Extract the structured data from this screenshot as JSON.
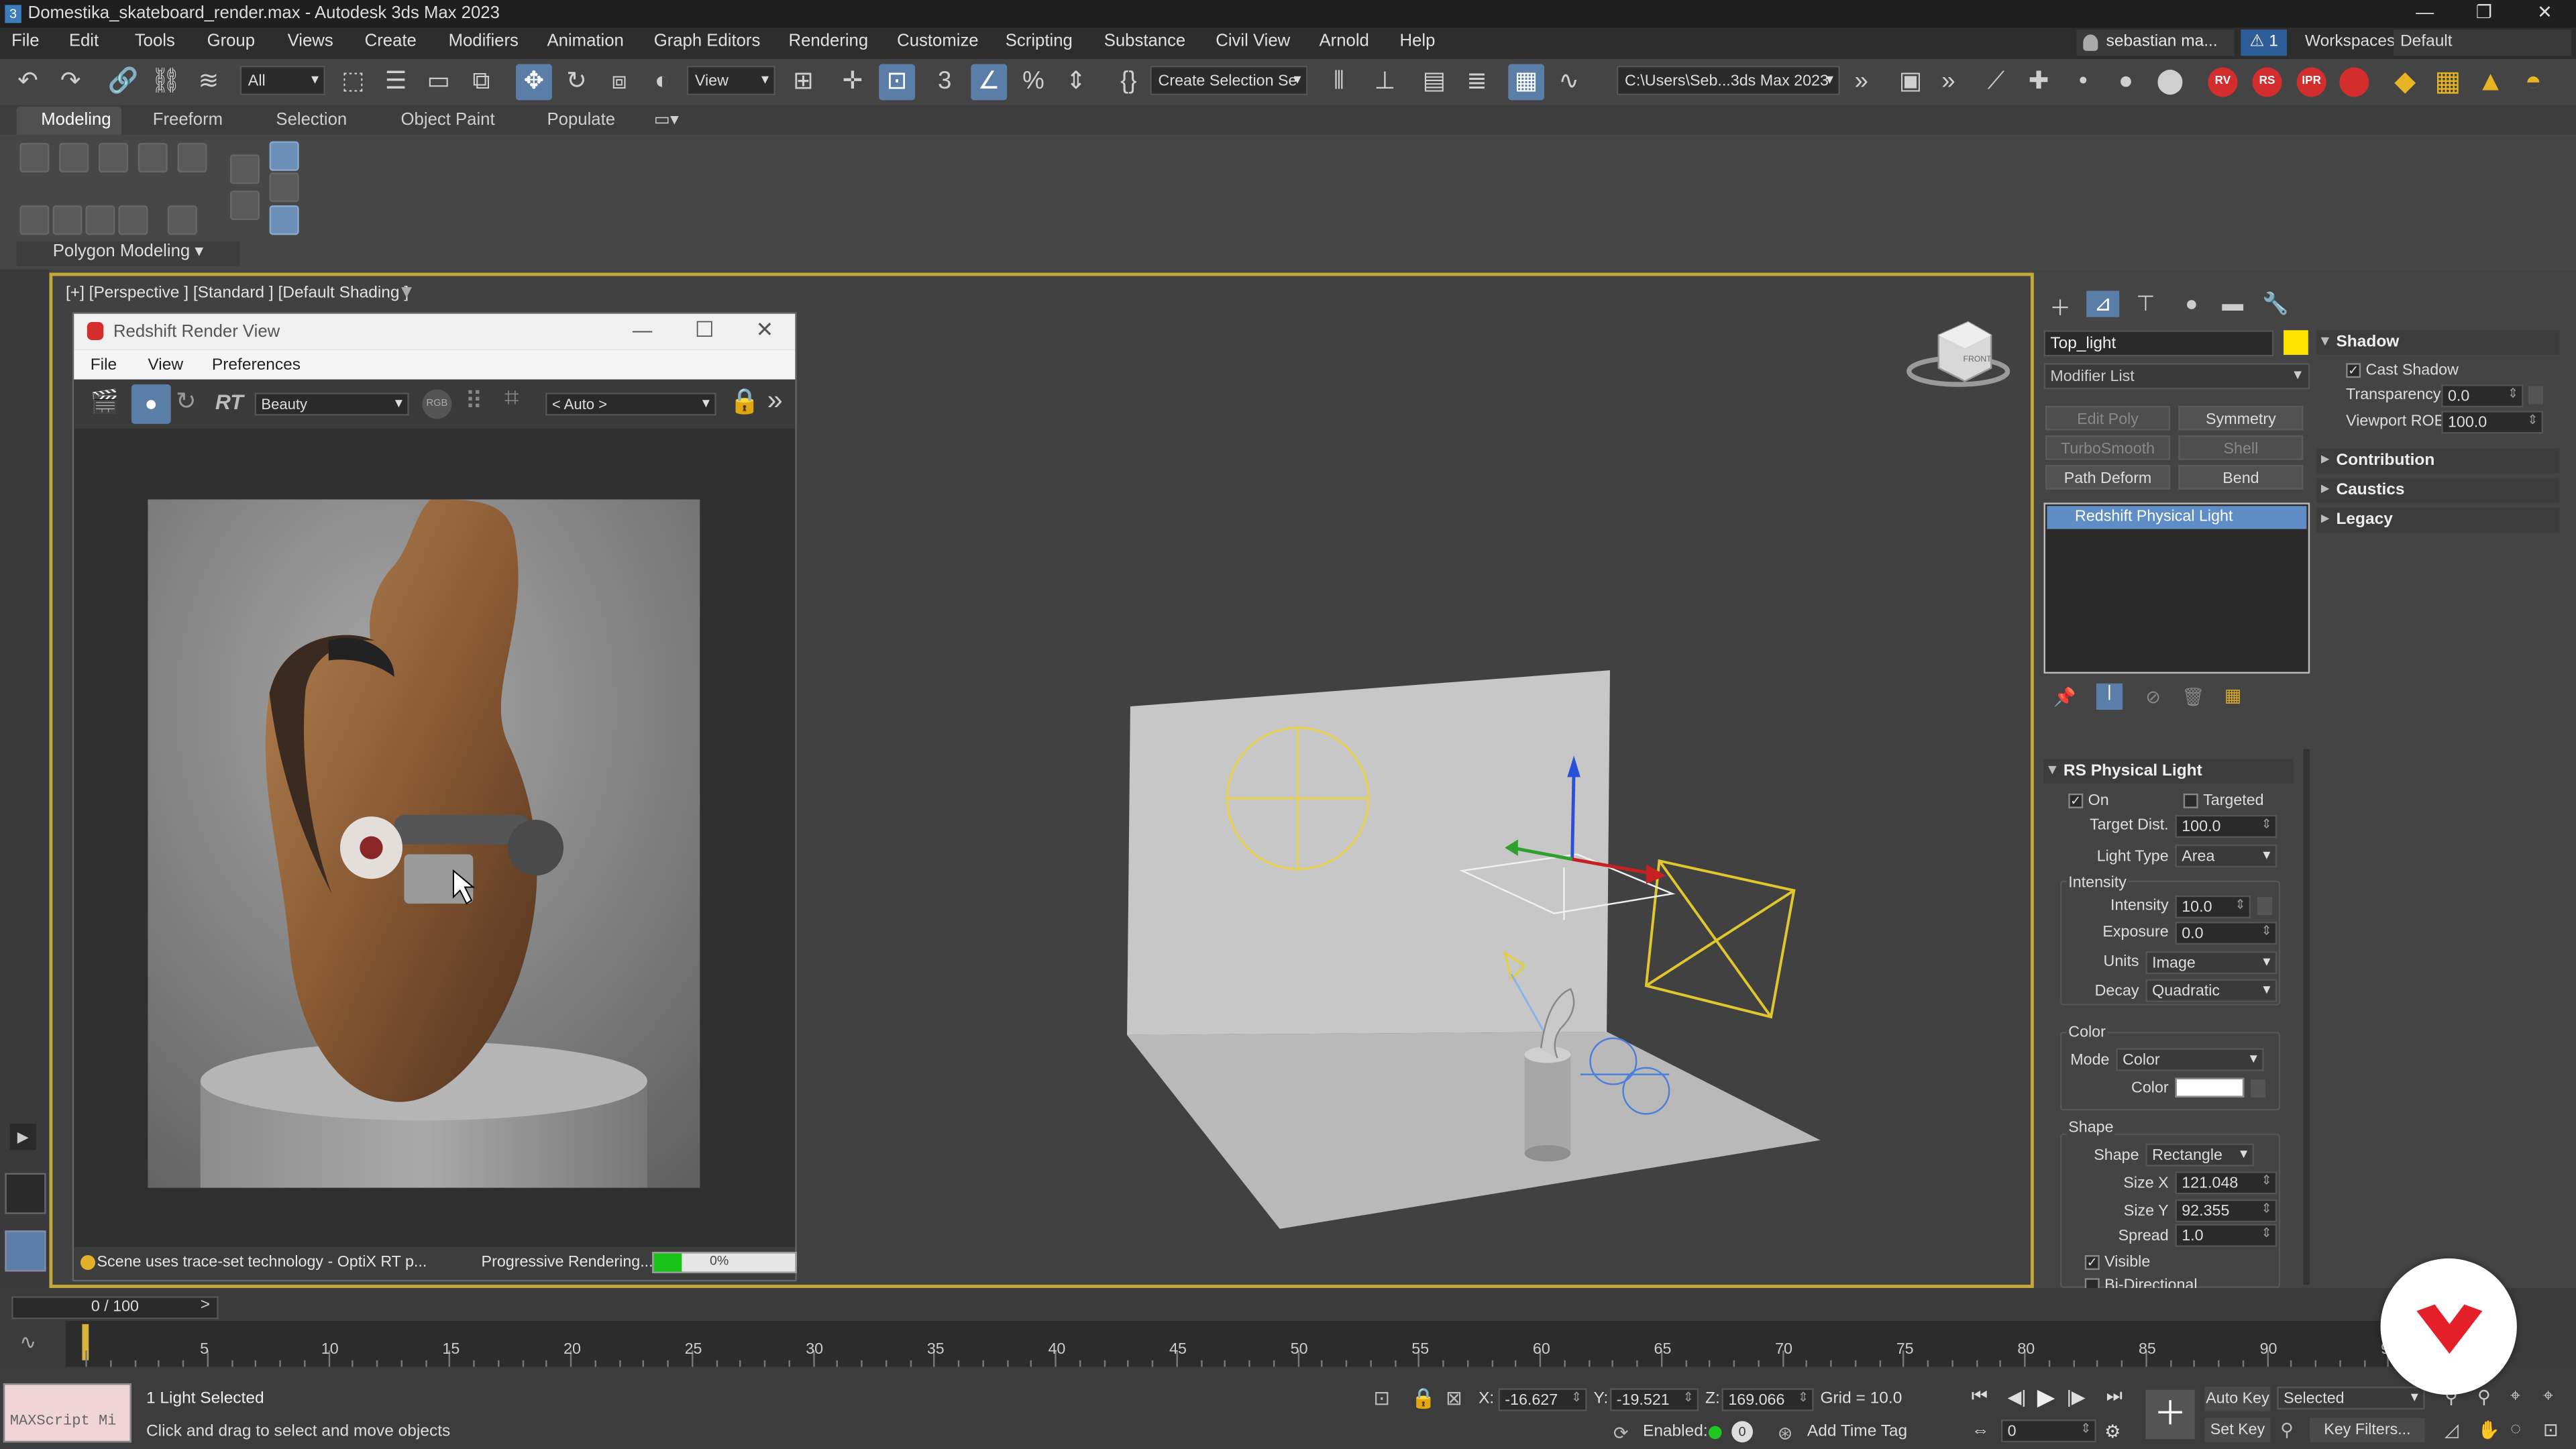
{
  "window": {
    "title": "Domestika_skateboard_render.max - Autodesk 3ds Max 2023",
    "app_icon": "3"
  },
  "menus": [
    "File",
    "Edit",
    "Tools",
    "Group",
    "Views",
    "Create",
    "Modifiers",
    "Animation",
    "Graph Editors",
    "Rendering",
    "Customize",
    "Scripting",
    "Substance",
    "Civil View",
    "Arnold",
    "Help"
  ],
  "account": {
    "user": "sebastian ma...",
    "alerts": "1",
    "workspaces_label": "Workspaces:",
    "workspace": "Default"
  },
  "toolbar": {
    "selection_filter": "All",
    "ref_coord": "View",
    "named_selection": "Create Selection Se",
    "project_path": "C:\\Users\\Seb...3ds Max 2023",
    "render_icons": [
      "RV",
      "RS",
      "IPR",
      ""
    ]
  },
  "ribbon": {
    "tabs": [
      "Modeling",
      "Freeform",
      "Selection",
      "Object Paint",
      "Populate"
    ],
    "panel_label": "Polygon Modeling"
  },
  "viewport": {
    "label": "[+] [Perspective ] [Standard ] [Default Shading ]",
    "viewcube_label": "FRONT"
  },
  "render_view": {
    "title": "Redshift Render View",
    "menus": [
      "File",
      "View",
      "Preferences"
    ],
    "rt_label": "RT",
    "aov": "Beauty",
    "rgb_label": "RGB",
    "camera": "< Auto >",
    "status_left": "Scene uses trace-set technology - OptiX RT p...",
    "status_right": "Progressive Rendering...",
    "progress": 0.2,
    "progress_text": "0%"
  },
  "command_panel": {
    "object_name": "Top_light",
    "object_color": "#ffe400",
    "modifier_list": "Modifier List",
    "modifier_buttons": [
      "Edit Poly",
      "Symmetry",
      "TurboSmooth",
      "Shell",
      "Path Deform",
      "Bend"
    ],
    "stack_item": "Redshift Physical Light",
    "rollout_title": "RS Physical Light",
    "on_label": "On",
    "targeted_label": "Targeted",
    "target_dist_label": "Target Dist.",
    "target_dist": "100.0",
    "light_type_label": "Light Type",
    "light_type": "Area",
    "intensity_group": "Intensity",
    "intensity_label": "Intensity",
    "intensity": "10.0",
    "exposure_label": "Exposure",
    "exposure": "0.0",
    "units_label": "Units",
    "units": "Image",
    "decay_label": "Decay",
    "decay": "Quadratic",
    "color_group": "Color",
    "mode_label": "Mode",
    "mode": "Color",
    "color_label": "Color",
    "color_value": "#ffffff",
    "shape_group": "Shape",
    "shape_label": "Shape",
    "shape": "Rectangle",
    "size_x_label": "Size X",
    "size_x": "121.048",
    "size_y_label": "Size Y",
    "size_y": "92.355",
    "spread_label": "Spread",
    "spread": "1.0",
    "visible_label": "Visible",
    "bidirectional_label": "Bi-Directional",
    "right_rollouts": {
      "shadow": "Shadow",
      "cast_shadow": "Cast Shadow",
      "transparency_label": "Transparency",
      "transparency": "0.0",
      "viewport_roe_label": "Viewport ROE",
      "viewport_roe": "100.0",
      "contribution": "Contribution",
      "caustics": "Caustics",
      "legacy": "Legacy"
    }
  },
  "timeline": {
    "frame": "0 / 100",
    "ticks": [
      "5",
      "10",
      "15",
      "20",
      "25",
      "30",
      "35",
      "40",
      "45",
      "50",
      "55",
      "60",
      "65",
      "70",
      "75",
      "80",
      "85",
      "90",
      "9"
    ]
  },
  "status": {
    "maxscript": "MAXScript Mi",
    "selection": "1 Light Selected",
    "prompt": "Click and drag to select and move objects",
    "x_label": "X:",
    "x": "-16.627",
    "y_label": "Y:",
    "y": "-19.521",
    "z_label": "Z:",
    "z": "169.066",
    "grid": "Grid = 10.0",
    "enabled_label": "Enabled:",
    "add_time_tag": "Add Time Tag",
    "auto_key": "Auto Key",
    "set_key": "Set Key",
    "selected": "Selected",
    "key_filters": "Key Filters...",
    "frame_field": "0"
  }
}
